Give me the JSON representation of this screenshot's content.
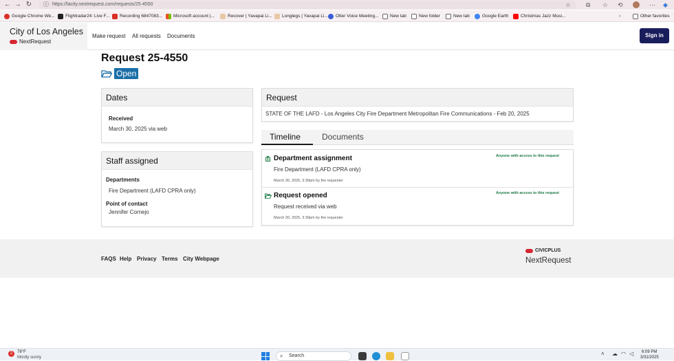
{
  "browser": {
    "url": "https://lacity.nextrequest.com/requests/25-4550",
    "bookmarks": [
      {
        "label": "Google Chrome We...",
        "color": "#d93025"
      },
      {
        "label": "Flightradar24: Live F...",
        "color": "#222222"
      },
      {
        "label": "Recording 6847083...",
        "color": "#d93025"
      },
      {
        "label": "Microsoft account |...",
        "color": "#f25022"
      },
      {
        "label": "Recover | Yavapai Li...",
        "color": "#e8c9a6"
      },
      {
        "label": "Longlegs | Yavapai Li...",
        "color": "#e8c9a6"
      },
      {
        "label": "Otter Voice Meeting...",
        "color": "#3a5fd6"
      },
      {
        "label": "New tab",
        "color": "#666666"
      },
      {
        "label": "New folder",
        "color": "#666666"
      },
      {
        "label": "New tab",
        "color": "#666666"
      },
      {
        "label": "Google Earth",
        "color": "#4285f4"
      },
      {
        "label": "Christmas Jazz Musi...",
        "color": "#ff0000"
      }
    ],
    "other_favorites": "Other favorites"
  },
  "header": {
    "city": "City of Los Angeles",
    "logo_text": "NextRequest",
    "nav": [
      "Make request",
      "All requests",
      "Documents"
    ],
    "signin_label": "Sign in"
  },
  "request": {
    "title": "Request 25-4550",
    "status": "Open",
    "status_color": "#1b6fa8"
  },
  "dates": {
    "heading": "Dates",
    "received_label": "Received",
    "received_value": "March 30, 2025 via web"
  },
  "staff": {
    "heading": "Staff assigned",
    "departments_label": "Departments",
    "departments_value": "Fire Department (LAFD CPRA only)",
    "poc_label": "Point of contact",
    "poc_value": "Jennifer Cornejo"
  },
  "request_card": {
    "heading": "Request",
    "body": "STATE OF THE LAFD - Los Angeles City Fire Department Metropolitan Fire Communications - Feb 20, 2025"
  },
  "tabs": [
    "Timeline",
    "Documents"
  ],
  "timeline": [
    {
      "icon": "building-icon",
      "title": "Department assignment",
      "desc": "Fire Department (LAFD CPRA only)",
      "meta": "March 30, 2025, 3:39pm by the requester",
      "visibility": "Anyone with access to this request"
    },
    {
      "icon": "folder-open-icon",
      "title": "Request opened",
      "desc": "Request received via web",
      "meta": "March 30, 2025, 3:39pm by the requester",
      "visibility": "Anyone with access to this request"
    }
  ],
  "footer": {
    "links": [
      "FAQS",
      "Help",
      "Privacy",
      "Terms",
      "City Webpage"
    ],
    "civic": "CIVICPLUS",
    "nr": "NextRequest"
  },
  "taskbar": {
    "weather_temp": "78°F",
    "weather_desc": "Mostly sunny",
    "weather_badge": "2",
    "search_label": "Search",
    "time": "6:09 PM",
    "date": "3/31/2025"
  },
  "colors": {
    "accent_red": "#d62630",
    "signin_bg": "#1a1d5c",
    "visibility_green": "#1e7a44"
  }
}
